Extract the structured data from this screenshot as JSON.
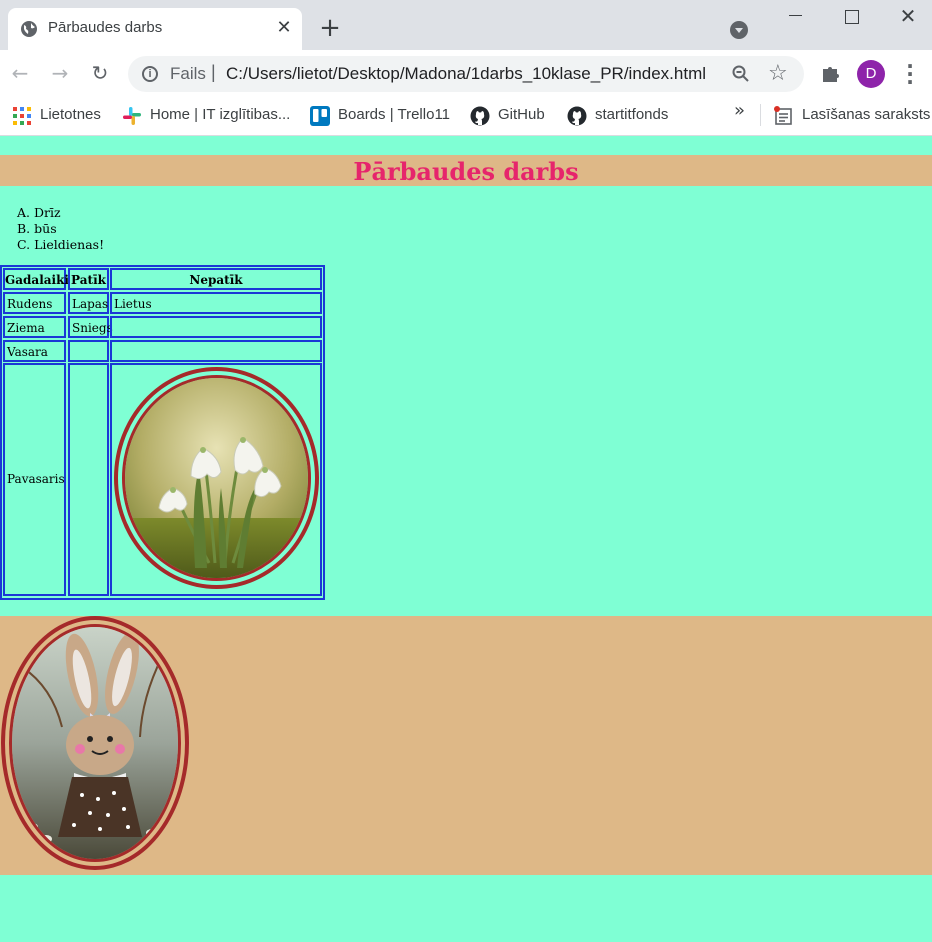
{
  "browser": {
    "tab_title": "Pārbaudes darbs",
    "url_scheme": "Fails",
    "url_sep": "|",
    "url_path": "C:/Users/lietot/Desktop/Madona/1darbs_10klase_PR/index.html",
    "profile_initial": "D",
    "bookmarks": [
      {
        "label": "Lietotnes",
        "icon": "apps-grid-icon"
      },
      {
        "label": "Home | IT izglītibas...",
        "icon": "slack-icon"
      },
      {
        "label": "Boards | Trello11",
        "icon": "trello-icon"
      },
      {
        "label": "GitHub",
        "icon": "github-icon"
      },
      {
        "label": "startitfonds",
        "icon": "github-icon"
      }
    ],
    "more_bookmarks": "»",
    "reading_list": "Lasīšanas saraksts"
  },
  "page": {
    "title": "Pārbaudes darbs",
    "list": [
      "Drīz",
      "būs",
      "Lieldienas!"
    ],
    "list_markers": [
      "A.",
      "B.",
      "C."
    ],
    "table": {
      "headers": [
        "Gadalaiki",
        "Patīk",
        "Nepatīk"
      ],
      "rows": [
        [
          "Rudens",
          "Lapas",
          "Lietus"
        ],
        [
          "Ziema",
          "Sniegs",
          ""
        ],
        [
          "Vasara",
          "",
          ""
        ],
        [
          "Pavasaris",
          "",
          ""
        ]
      ]
    },
    "colors": {
      "background": "#7fffd4",
      "band": "#deb887",
      "title": "#e6256c",
      "table_border": "#1a38d6",
      "image_frame": "#a52a2a"
    }
  }
}
